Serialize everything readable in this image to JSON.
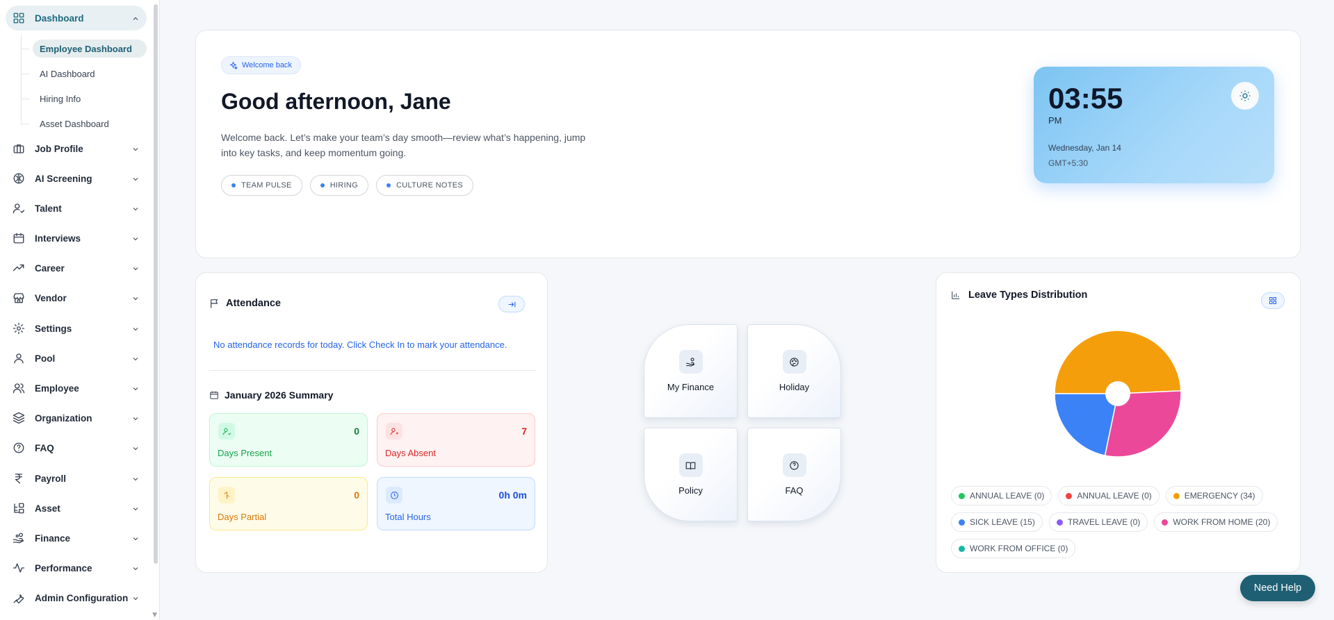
{
  "sidebar": {
    "items": [
      {
        "label": "Dashboard",
        "icon": "grid-icon"
      },
      {
        "label": "Job Profile",
        "icon": "briefcase-icon"
      },
      {
        "label": "AI Screening",
        "icon": "brain-icon"
      },
      {
        "label": "Talent",
        "icon": "user-check-icon"
      },
      {
        "label": "Interviews",
        "icon": "calendar-icon"
      },
      {
        "label": "Career",
        "icon": "trending-up-icon"
      },
      {
        "label": "Vendor",
        "icon": "store-icon"
      },
      {
        "label": "Settings",
        "icon": "gear-icon"
      },
      {
        "label": "Pool",
        "icon": "user-icon"
      },
      {
        "label": "Employee",
        "icon": "users-icon"
      },
      {
        "label": "Organization",
        "icon": "layers-icon"
      },
      {
        "label": "FAQ",
        "icon": "help-circle-icon"
      },
      {
        "label": "Payroll",
        "icon": "rupee-icon"
      },
      {
        "label": "Asset",
        "icon": "asset-icon"
      },
      {
        "label": "Finance",
        "icon": "hand-coins-icon"
      },
      {
        "label": "Performance",
        "icon": "activity-icon"
      },
      {
        "label": "Admin Configuration",
        "icon": "wrench-icon"
      }
    ],
    "dashboard_sub": [
      "Employee Dashboard",
      "AI Dashboard",
      "Hiring Info",
      "Asset Dashboard"
    ]
  },
  "welcome": {
    "pill": "Welcome back",
    "greeting": "Good afternoon, Jane",
    "description": "Welcome back. Let’s make your team’s day smooth—review what’s happening, jump into key tasks, and keep momentum going.",
    "tags": [
      "TEAM PULSE",
      "HIRING",
      "CULTURE NOTES"
    ]
  },
  "clock": {
    "time": "03:55",
    "ampm": "PM",
    "date": "Wednesday, Jan 14",
    "timezone": "GMT+5:30"
  },
  "attendance": {
    "title": "Attendance",
    "message": "No attendance records for today. Click Check In to mark your attendance.",
    "summary_title": "January 2026 Summary",
    "stats": [
      {
        "label": "Days Present",
        "value": "0"
      },
      {
        "label": "Days Absent",
        "value": "7"
      },
      {
        "label": "Days Partial",
        "value": "0"
      },
      {
        "label": "Total Hours",
        "value": "0h 0m"
      }
    ]
  },
  "quick_links": [
    "My Finance",
    "Holiday",
    "Policy",
    "FAQ"
  ],
  "leave": {
    "title": "Leave Types Distribution",
    "legend": [
      {
        "label": "ANNUAL LEAVE (0)",
        "color": "#22c55e"
      },
      {
        "label": "ANNUAL LEAVE (0)",
        "color": "#ef4444"
      },
      {
        "label": "EMERGENCY (34)",
        "color": "#f59e0b"
      },
      {
        "label": "SICK LEAVE (15)",
        "color": "#3b82f6"
      },
      {
        "label": "TRAVEL LEAVE (0)",
        "color": "#8b5cf6"
      },
      {
        "label": "WORK FROM HOME (20)",
        "color": "#ec4899"
      },
      {
        "label": "WORK FROM OFFICE (0)",
        "color": "#14b8a6"
      }
    ],
    "slices": [
      {
        "name": "EMERGENCY",
        "value": 34,
        "color": "#f59e0b"
      },
      {
        "name": "WORK FROM HOME",
        "value": 20,
        "color": "#ec4899"
      },
      {
        "name": "SICK LEAVE",
        "value": 15,
        "color": "#3b82f6"
      }
    ]
  },
  "help_button": "Need Help"
}
